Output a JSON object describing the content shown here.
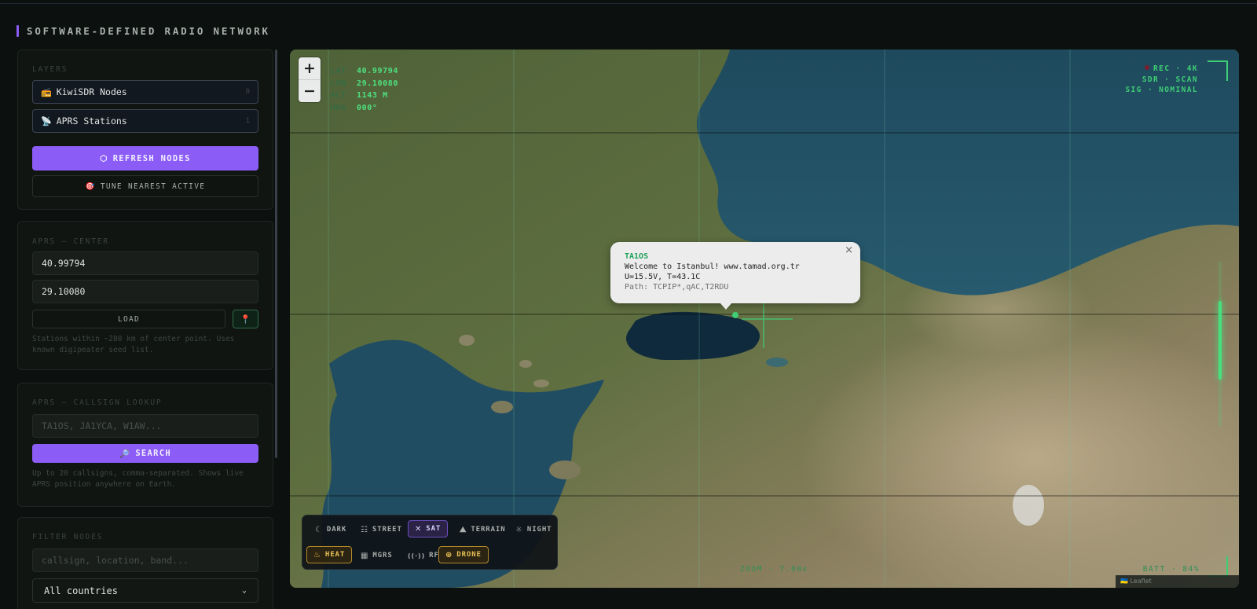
{
  "app": {
    "title": "SOFTWARE-DEFINED RADIO NETWORK"
  },
  "layers": {
    "heading": "LAYERS",
    "items": [
      {
        "icon": "radio-icon",
        "emoji": "📻",
        "label": "KiwiSDR Nodes",
        "count": "0"
      },
      {
        "icon": "satellite-antenna-icon",
        "emoji": "📡",
        "label": "APRS Stations",
        "count": "1"
      }
    ],
    "refresh_label": "REFRESH NODES",
    "refresh_icon": "⬡",
    "tune_label": "TUNE NEAREST ACTIVE",
    "tune_icon": "🎯"
  },
  "aprs_center": {
    "heading": "APRS — CENTER",
    "lat": "40.99794",
    "lon": "29.10080",
    "load_label": "LOAD",
    "pin_icon": "📍",
    "hint": "Stations within ~280 km of center point. Uses known digipeater seed list."
  },
  "callsign": {
    "heading": "APRS — CALLSIGN LOOKUP",
    "placeholder": "TA1OS, JA1YCA, W1AW...",
    "search_label": "SEARCH",
    "search_icon": "🔎",
    "hint": "Up to 20 callsigns, comma-separated. Shows live APRS position anywhere on Earth."
  },
  "filter": {
    "heading": "FILTER NODES",
    "placeholder": "callsign, location, band...",
    "country_selected": "All countries"
  },
  "map": {
    "zoom_in": "+",
    "zoom_out": "−",
    "lat_k": "LAT",
    "lat_v": "40.99794",
    "lon_k": "LON",
    "lon_v": "29.10080",
    "alt_k": "ALT",
    "alt_v": "1143 M",
    "hdg_k": "HDG",
    "hdg_v": "000°",
    "rec": "REC · 4K",
    "sdr": "SDR · SCAN",
    "sig": "SIG · NOMINAL",
    "zoom_status": "ZOOM · 7.00x",
    "battery": "BATT · 84%",
    "attribution": "🇺🇦 Leaflet"
  },
  "popup": {
    "callsign": "TA1OS",
    "line1": "Welcome to Istanbul! www.tamad.org.tr",
    "line2": "U=15.5V, T=43.1C",
    "path": "Path: TCPIP*,qAC,T2RDU",
    "close": "×"
  },
  "basemaps": [
    {
      "label": "DARK",
      "icon": "moon-icon",
      "glyph": "☾"
    },
    {
      "label": "STREET",
      "icon": "grid-icon",
      "glyph": "☷"
    },
    {
      "label": "SAT",
      "icon": "satellite-icon",
      "glyph": "✕",
      "active": true
    },
    {
      "label": "TERRAIN",
      "icon": "mountain-icon",
      "glyph": "⛰"
    },
    {
      "label": "NIGHT",
      "icon": "sun-icon",
      "glyph": "☼"
    }
  ],
  "overlays": [
    {
      "label": "HEAT",
      "icon": "flame-icon",
      "glyph": "♨",
      "active": true
    },
    {
      "label": "MGRS",
      "icon": "grid-square-icon",
      "glyph": "▦"
    },
    {
      "label": "RF",
      "icon": "broadcast-icon",
      "glyph": "((·))"
    },
    {
      "label": "DRONE",
      "icon": "crosshair-icon",
      "glyph": "⊕",
      "active": true
    }
  ],
  "colors": {
    "accent": "#8b5cf6",
    "hud_green": "#3ecf74",
    "gold": "#e9c056"
  }
}
